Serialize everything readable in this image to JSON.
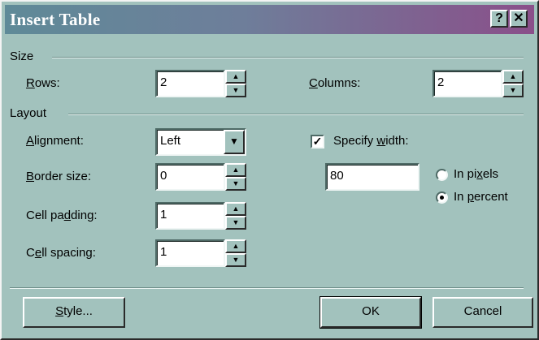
{
  "window": {
    "title": "Insert Table",
    "help_button": "?",
    "close_button": "✕"
  },
  "size": {
    "group_label": "Size",
    "rows_label_access": "R",
    "rows_label_rest": "ows:",
    "rows_value": "2",
    "columns_label_access": "C",
    "columns_label_rest": "olumns:",
    "columns_value": "2"
  },
  "layout": {
    "group_label": "Layout",
    "alignment_label_access": "A",
    "alignment_label_rest": "lignment:",
    "alignment_value": "Left",
    "border_label_access": "B",
    "border_label_rest": "order size:",
    "border_value": "0",
    "padding_label_pre": "Cell pa",
    "padding_label_access": "d",
    "padding_label_rest": "ding:",
    "padding_value": "1",
    "spacing_label_pre": "C",
    "spacing_label_access": "e",
    "spacing_label_rest": "ll spacing:",
    "spacing_value": "1",
    "specify_width_pre": "Specify ",
    "specify_width_access": "w",
    "specify_width_rest": "idth:",
    "specify_width_checked": true,
    "width_value": "80",
    "in_pixels_pre": "In pi",
    "in_pixels_access": "x",
    "in_pixels_rest": "els",
    "in_percent_pre": "In ",
    "in_percent_access": "p",
    "in_percent_rest": "ercent",
    "selected_unit": "percent"
  },
  "buttons": {
    "style_access": "S",
    "style_rest": "tyle...",
    "ok": "OK",
    "cancel": "Cancel"
  },
  "icons": {
    "spin_up": "▲",
    "spin_down": "▼",
    "dropdown": "▼",
    "check": "✓"
  },
  "colors": {
    "dialog_bg": "#a2c2bd",
    "title_gradient_start": "#5f8a98",
    "title_gradient_end": "#8a4f8a"
  }
}
